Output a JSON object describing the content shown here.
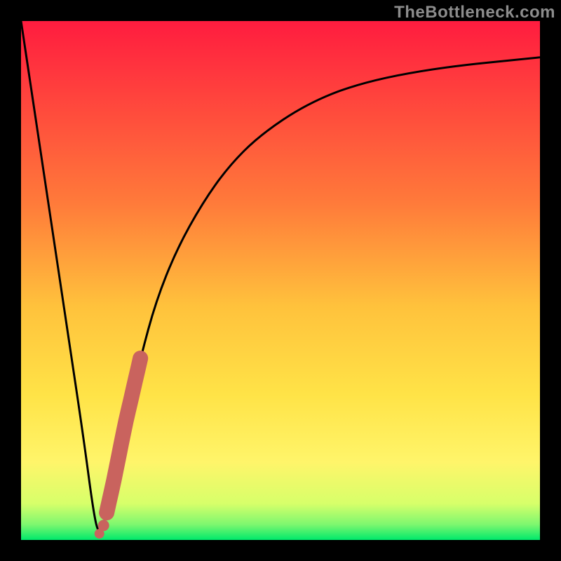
{
  "watermark": "TheBottleneck.com",
  "colors": {
    "frame": "#000000",
    "top": "#ff1c3f",
    "mid_upper": "#ffa940",
    "mid": "#ffe347",
    "mid_lower": "#fff56a",
    "near_bottom": "#d7ff6a",
    "bottom": "#00e96b",
    "curve_stroke": "#000000",
    "blob": "#c9635e",
    "watermark": "#8c8c8c"
  },
  "chart_data": {
    "type": "line",
    "title": "",
    "xlabel": "",
    "ylabel": "",
    "xlim": [
      0,
      100
    ],
    "ylim": [
      0,
      100
    ],
    "series": [
      {
        "name": "bottleneck-curve",
        "x": [
          0,
          3,
          6,
          9,
          12,
          14,
          15,
          16,
          18,
          20,
          23,
          26,
          30,
          35,
          40,
          46,
          55,
          65,
          80,
          100
        ],
        "y": [
          100,
          80,
          60,
          40,
          20,
          5,
          1,
          3,
          12,
          22,
          35,
          46,
          56,
          65,
          72,
          78,
          84,
          88,
          91,
          93
        ]
      }
    ],
    "annotations": [
      {
        "name": "highlight-segment",
        "type": "thick-overlay",
        "x_range": [
          16.5,
          23
        ],
        "y_range": [
          3,
          36
        ],
        "color": "#c9635e"
      }
    ],
    "gradient_stops": [
      {
        "pos": 0.0,
        "color": "#ff1c3f"
      },
      {
        "pos": 0.35,
        "color": "#ff7a3a"
      },
      {
        "pos": 0.55,
        "color": "#ffc23c"
      },
      {
        "pos": 0.72,
        "color": "#ffe347"
      },
      {
        "pos": 0.85,
        "color": "#fff56a"
      },
      {
        "pos": 0.93,
        "color": "#d7ff6a"
      },
      {
        "pos": 0.97,
        "color": "#7ef76f"
      },
      {
        "pos": 1.0,
        "color": "#00e96b"
      }
    ]
  }
}
